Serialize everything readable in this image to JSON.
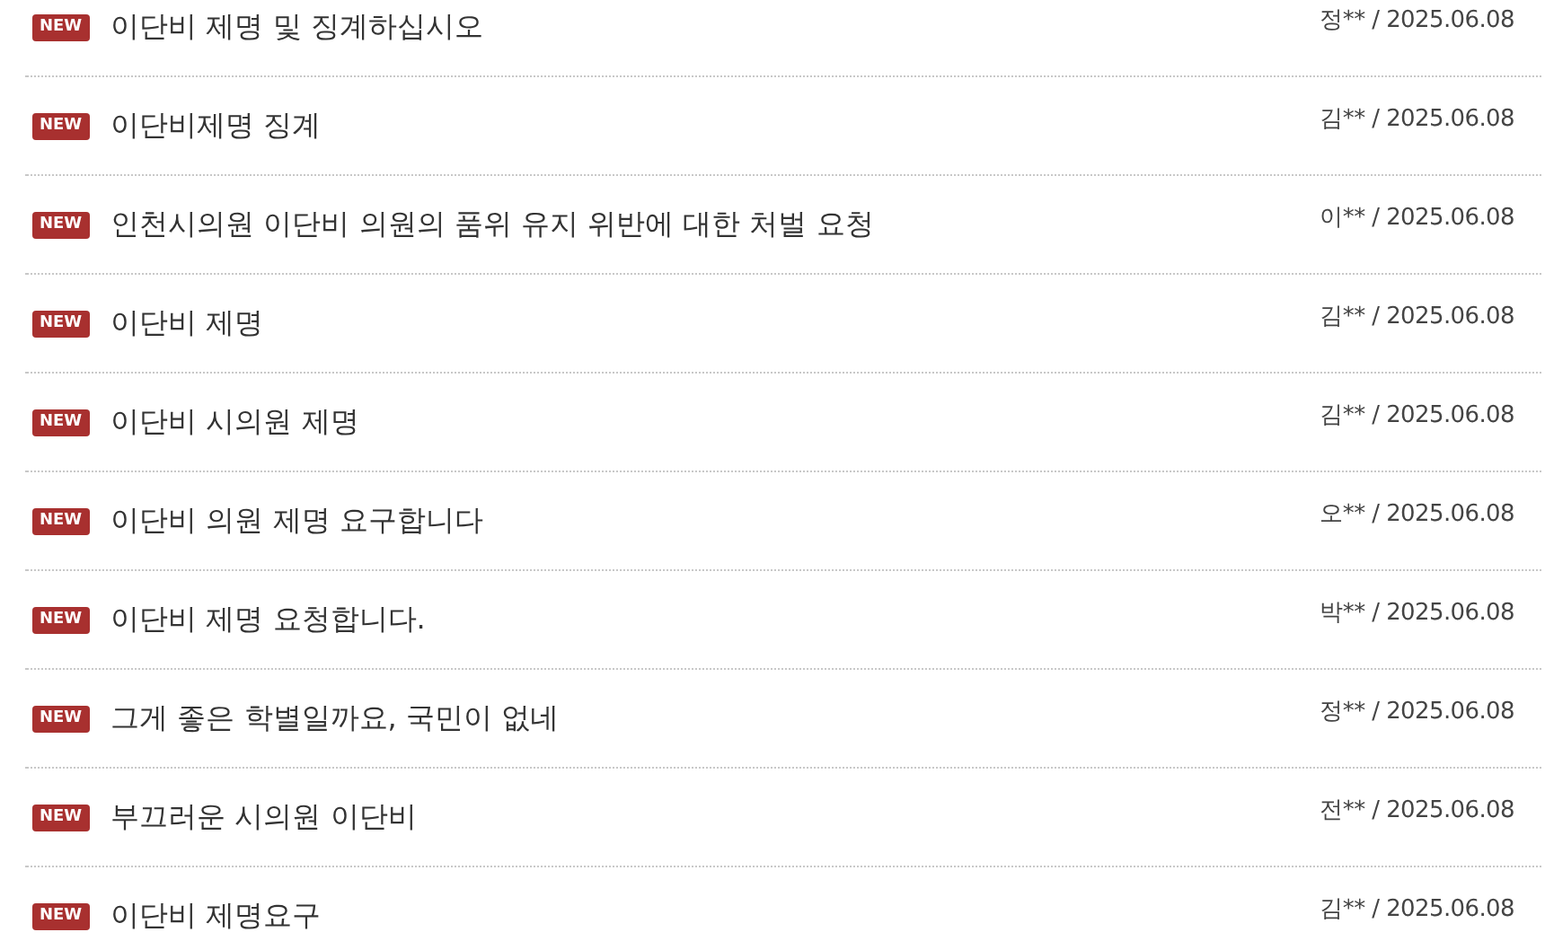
{
  "posts": [
    {
      "badge": "NEW",
      "title": "이단비 제명 및 징계하십시오",
      "meta": "정** / 2025.06.08"
    },
    {
      "badge": "NEW",
      "title": "이단비제명 징계",
      "meta": "김** / 2025.06.08"
    },
    {
      "badge": "NEW",
      "title": "인천시의원 이단비 의원의 품위 유지 위반에 대한 처벌 요청",
      "meta": "이** / 2025.06.08"
    },
    {
      "badge": "NEW",
      "title": "이단비 제명",
      "meta": "김** / 2025.06.08"
    },
    {
      "badge": "NEW",
      "title": "이단비 시의원 제명",
      "meta": "김** / 2025.06.08"
    },
    {
      "badge": "NEW",
      "title": "이단비 의원 제명 요구합니다",
      "meta": "오** / 2025.06.08"
    },
    {
      "badge": "NEW",
      "title": "이단비 제명 요청합니다.",
      "meta": "박** / 2025.06.08"
    },
    {
      "badge": "NEW",
      "title": "그게 좋은 학별일까요, 국민이 없네",
      "meta": "정** / 2025.06.08"
    },
    {
      "badge": "NEW",
      "title": "부끄러운 시의원 이단비",
      "meta": "전** / 2025.06.08"
    },
    {
      "badge": "NEW",
      "title": "이단비 제명요구",
      "meta": "김** / 2025.06.08"
    }
  ]
}
